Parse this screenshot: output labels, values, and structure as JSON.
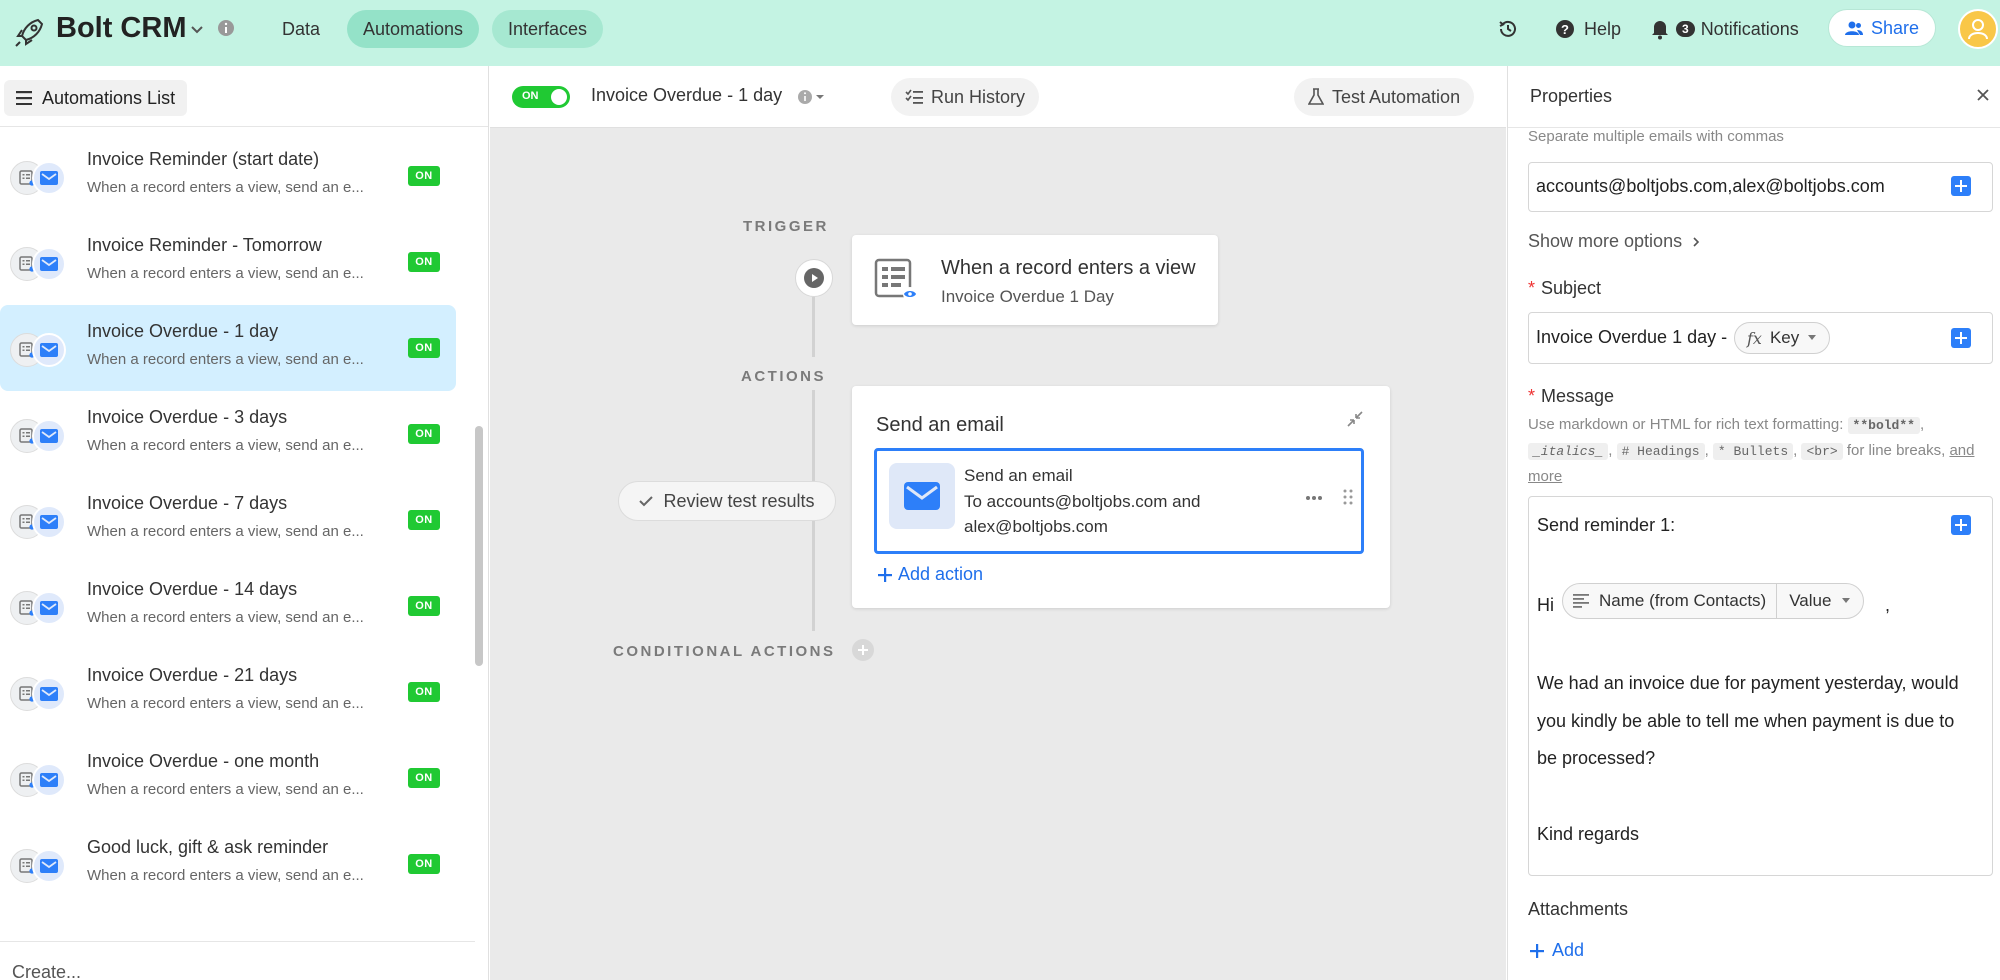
{
  "app": {
    "title": "Bolt CRM",
    "nav_tabs": [
      "Data",
      "Automations",
      "Interfaces"
    ],
    "history_label": "",
    "help_label": "Help",
    "notifications_count": "3",
    "notifications_label": "Notifications",
    "share_label": "Share"
  },
  "sidebar": {
    "list_button": "Automations List",
    "items": [
      {
        "title": "",
        "subtitle": "When a record enters a view, send an e...",
        "status": ""
      },
      {
        "title": "Invoice Reminder (start date)",
        "subtitle": "When a record enters a view, send an e...",
        "status": "ON"
      },
      {
        "title": "Invoice Reminder - Tomorrow",
        "subtitle": "When a record enters a view, send an e...",
        "status": "ON"
      },
      {
        "title": "Invoice Overdue - 1 day",
        "subtitle": "When a record enters a view, send an e...",
        "status": "ON"
      },
      {
        "title": "Invoice Overdue - 3 days",
        "subtitle": "When a record enters a view, send an e...",
        "status": "ON"
      },
      {
        "title": "Invoice Overdue - 7 days",
        "subtitle": "When a record enters a view, send an e...",
        "status": "ON"
      },
      {
        "title": "Invoice Overdue - 14 days",
        "subtitle": "When a record enters a view, send an e...",
        "status": "ON"
      },
      {
        "title": "Invoice Overdue - 21 days",
        "subtitle": "When a record enters a view, send an e...",
        "status": "ON"
      },
      {
        "title": "Invoice Overdue - one month",
        "subtitle": "When a record enters a view, send an e...",
        "status": "ON"
      },
      {
        "title": "Good luck, gift & ask reminder",
        "subtitle": "When a record enters a view, send an e...",
        "status": "ON"
      }
    ],
    "create_label": "Create..."
  },
  "automation": {
    "toggle_label": "ON",
    "name": "Invoice Overdue - 1 day",
    "run_history_label": "Run History",
    "test_label": "Test Automation",
    "trigger_section": "TRIGGER",
    "actions_section": "ACTIONS",
    "conditional_section": "CONDITIONAL ACTIONS",
    "trigger_title": "When a record enters a view",
    "trigger_subtitle": "Invoice Overdue 1 Day",
    "action_card_title": "Send an email",
    "action_title": "Send an email",
    "action_to_line1": "To accounts@boltjobs.com and",
    "action_to_line2": "alex@boltjobs.com",
    "add_action_label": "Add action",
    "review_label": "Review test results"
  },
  "properties": {
    "title": "Properties",
    "emails_hint": "Separate multiple emails with commas",
    "to_value": "accounts@boltjobs.com,alex@boltjobs.com",
    "show_more": "Show more options",
    "subject_label": "Subject",
    "subject_prefix": "Invoice Overdue 1 day -",
    "subject_chip": "Key",
    "message_label": "Message",
    "md_hint_prefix": "Use markdown or HTML for rich text formatting:",
    "md_bold": "**bold**",
    "md_italics": "_italics_",
    "md_headings": "# Headings",
    "md_bullets": "* Bullets",
    "md_br": "<br>",
    "md_for_breaks": "for line breaks,",
    "md_link": "and more",
    "message_line1": "Send reminder 1:",
    "message_hi": "Hi",
    "message_chip_field": "Name (from Contacts)",
    "message_chip_value": "Value",
    "message_comma": ",",
    "message_body1": "We had an invoice due for payment yesterday, would",
    "message_body2": "you kindly be able to tell me when payment is due to",
    "message_body3": "be processed?",
    "message_signoff": "Kind regards",
    "attachments_label": "Attachments",
    "add_label": "Add"
  },
  "colors": {
    "topbar": "#c4f3e3",
    "accent_blue": "#2d7ff9",
    "on_green": "#20c933",
    "selected_row": "#d3efff"
  }
}
